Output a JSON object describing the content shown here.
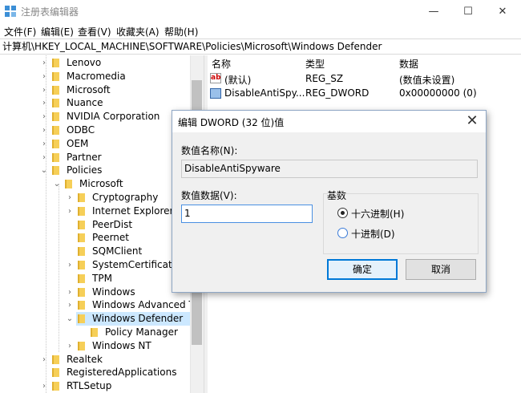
{
  "window": {
    "title": "注册表编辑器",
    "minimize_glyph": "—",
    "maximize_glyph": "☐",
    "close_glyph": "✕"
  },
  "menu": [
    "文件(F)",
    "编辑(E)",
    "查看(V)",
    "收藏夹(A)",
    "帮助(H)"
  ],
  "address": "计算机\\HKEY_LOCAL_MACHINE\\SOFTWARE\\Policies\\Microsoft\\Windows Defender",
  "tree": [
    {
      "label": "Lenovo",
      "expandable": true,
      "expanded": false,
      "level": 1
    },
    {
      "label": "Macromedia",
      "expandable": true,
      "expanded": false,
      "level": 1
    },
    {
      "label": "Microsoft",
      "expandable": true,
      "expanded": false,
      "level": 1
    },
    {
      "label": "Nuance",
      "expandable": true,
      "expanded": false,
      "level": 1
    },
    {
      "label": "NVIDIA Corporation",
      "expandable": true,
      "expanded": false,
      "level": 1
    },
    {
      "label": "ODBC",
      "expandable": true,
      "expanded": false,
      "level": 1
    },
    {
      "label": "OEM",
      "expandable": true,
      "expanded": false,
      "level": 1
    },
    {
      "label": "Partner",
      "expandable": true,
      "expanded": false,
      "level": 1
    },
    {
      "label": "Policies",
      "expandable": true,
      "expanded": true,
      "level": 1
    },
    {
      "label": "Microsoft",
      "expandable": true,
      "expanded": true,
      "level": 2
    },
    {
      "label": "Cryptography",
      "expandable": true,
      "expanded": false,
      "level": 3
    },
    {
      "label": "Internet Explorer",
      "expandable": true,
      "expanded": false,
      "level": 3
    },
    {
      "label": "PeerDist",
      "expandable": false,
      "expanded": false,
      "level": 3
    },
    {
      "label": "Peernet",
      "expandable": false,
      "expanded": false,
      "level": 3
    },
    {
      "label": "SQMClient",
      "expandable": false,
      "expanded": false,
      "level": 3
    },
    {
      "label": "SystemCertificate",
      "expandable": true,
      "expanded": false,
      "level": 3
    },
    {
      "label": "TPM",
      "expandable": false,
      "expanded": false,
      "level": 3
    },
    {
      "label": "Windows",
      "expandable": true,
      "expanded": false,
      "level": 3
    },
    {
      "label": "Windows Advanced T",
      "expandable": true,
      "expanded": false,
      "level": 3
    },
    {
      "label": "Windows Defender",
      "expandable": true,
      "expanded": true,
      "level": 3,
      "selected": true
    },
    {
      "label": "Policy Manager",
      "expandable": false,
      "expanded": false,
      "level": 4
    },
    {
      "label": "Windows NT",
      "expandable": true,
      "expanded": false,
      "level": 3
    },
    {
      "label": "Realtek",
      "expandable": true,
      "expanded": false,
      "level": 1
    },
    {
      "label": "RegisteredApplications",
      "expandable": false,
      "expanded": false,
      "level": 1
    },
    {
      "label": "RTLSetup",
      "expandable": true,
      "expanded": false,
      "level": 1
    }
  ],
  "list": {
    "headers": {
      "name": "名称",
      "type": "类型",
      "data": "数据"
    },
    "rows": [
      {
        "icon": "string-value-icon",
        "icon_text": "ab",
        "name": "(默认)",
        "type": "REG_SZ",
        "data": "(数值未设置)"
      },
      {
        "icon": "binary-value-icon",
        "icon_text": "",
        "name": "DisableAntiSpy...",
        "type": "REG_DWORD",
        "data": "0x00000000 (0)"
      }
    ]
  },
  "dialog": {
    "title": "编辑 DWORD (32 位)值",
    "close_glyph": "✕",
    "name_label": "数值名称(N):",
    "name_value": "DisableAntiSpyware",
    "data_label": "数值数据(V):",
    "data_value": "1",
    "base_label": "基数",
    "base_options": [
      {
        "label": "十六进制(H)",
        "checked": true
      },
      {
        "label": "十进制(D)",
        "checked": false
      }
    ],
    "ok_label": "确定",
    "cancel_label": "取消"
  },
  "colors": {
    "selection": "#cce8ff",
    "folder": "#f6cf58",
    "accent": "#0078d7"
  }
}
